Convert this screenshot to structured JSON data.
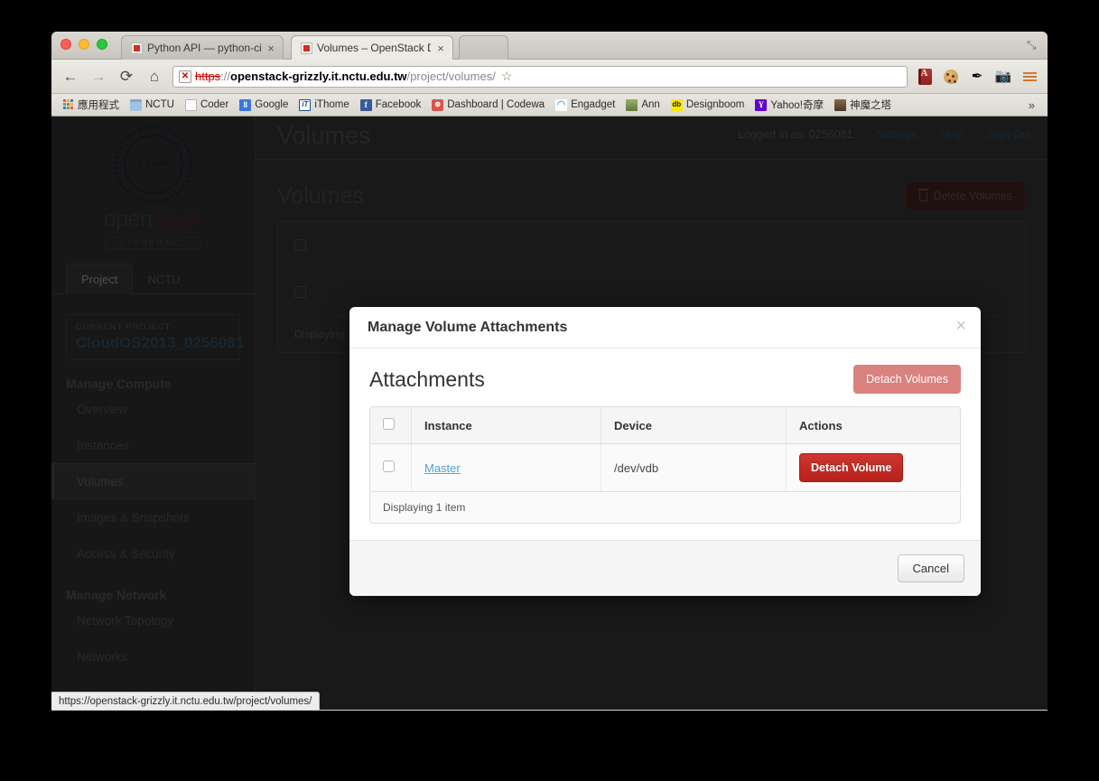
{
  "browser": {
    "tabs": [
      {
        "title": "Python API — python-cind",
        "favicon": "red-square-favicon",
        "active": false,
        "close": "×"
      },
      {
        "title": "Volumes – OpenStack Dash",
        "favicon": "red-square-favicon",
        "active": true,
        "close": "×"
      }
    ],
    "nav": {
      "back": "←",
      "forward": "→",
      "reload": "⟳",
      "home": "⌂"
    },
    "omnibox": {
      "ssl_glyph": "✕",
      "scheme": "https",
      "separator": "://",
      "host": "openstack-grizzly.it.nctu.edu.tw",
      "path": "/project/volumes/",
      "star": "☆"
    },
    "extensions": [
      {
        "name": "dictionary-extension-icon",
        "glyph": "A"
      },
      {
        "name": "cookie-extension-icon",
        "glyph": ""
      },
      {
        "name": "eyedropper-extension-icon",
        "glyph": "✒"
      },
      {
        "name": "screenshot-camera-extension-icon",
        "glyph": "📷"
      }
    ],
    "menu_label": "chrome-menu",
    "expand_glyph": "⤡",
    "bookmarks": [
      {
        "label": "應用程式",
        "icon": "apps-grid-icon"
      },
      {
        "label": "NCTU",
        "icon": "folder-icon"
      },
      {
        "label": "Coder",
        "icon": "page-icon"
      },
      {
        "label": "Google",
        "icon": "google-icon",
        "glyph": "8"
      },
      {
        "label": "iThome",
        "icon": "ithome-icon",
        "glyph": "iT"
      },
      {
        "label": "Facebook",
        "icon": "facebook-icon",
        "glyph": "f"
      },
      {
        "label": "Dashboard | Codewa",
        "icon": "codewars-icon",
        "glyph": "⊛"
      },
      {
        "label": "Engadget",
        "icon": "engadget-rss-icon",
        "glyph": "◠"
      },
      {
        "label": "Ann",
        "icon": "photo-thumbnail-icon",
        "glyph": ""
      },
      {
        "label": "Designboom",
        "icon": "designboom-icon",
        "glyph": "db"
      },
      {
        "label": "Yahoo!奇摩",
        "icon": "yahoo-icon",
        "glyph": "Y"
      },
      {
        "label": "神魔之塔",
        "icon": "tower-of-saviors-icon",
        "glyph": ""
      }
    ],
    "bookmarks_overflow": "»"
  },
  "status_bar": {
    "url": "https://openstack-grizzly.it.nctu.edu.tw/project/volumes/"
  },
  "sidebar": {
    "brand": {
      "seal_text": "E S 1896",
      "word_open": "open",
      "word_stack": "stack",
      "sub": "DASHBOARD"
    },
    "project_tabs": [
      {
        "label": "Project",
        "active": true
      },
      {
        "label": "NCTU",
        "active": false
      }
    ],
    "current_project": {
      "label": "CURRENT PROJECT",
      "value": "CloudOS2013_0256081"
    },
    "groups": [
      {
        "title": "Manage Compute",
        "items": [
          {
            "label": "Overview",
            "active": false
          },
          {
            "label": "Instances",
            "active": false
          },
          {
            "label": "Volumes",
            "active": true
          },
          {
            "label": "Images & Snapshots",
            "active": false
          },
          {
            "label": "Access & Security",
            "active": false
          }
        ]
      },
      {
        "title": "Manage Network",
        "items": [
          {
            "label": "Network Topology",
            "active": false
          },
          {
            "label": "Networks",
            "active": false
          }
        ]
      }
    ]
  },
  "header": {
    "page_title": "Volumes",
    "logged_in": "Logged in as: 0256081",
    "links": [
      {
        "label": "Settings"
      },
      {
        "label": "Help"
      },
      {
        "label": "Sign Out"
      }
    ]
  },
  "main": {
    "section_title": "Volumes",
    "delete_volumes_label": "Delete Volumes",
    "footer_text": "Displaying"
  },
  "modal": {
    "title": "Manage Volume Attachments",
    "close_glyph": "×",
    "section_title": "Attachments",
    "detach_volumes_label": "Detach Volumes",
    "table": {
      "columns": [
        "",
        "Instance",
        "Device",
        "Actions"
      ],
      "rows": [
        {
          "checked": false,
          "instance": "Master",
          "device": "/dev/vdb",
          "action_label": "Detach Volume"
        }
      ],
      "footer": "Displaying 1 item"
    },
    "cancel_label": "Cancel"
  },
  "colors": {
    "danger": "#cc2a24",
    "danger_muted": "#d9827e",
    "link": "#4ea3d8",
    "page_bg": "#2f2f2f",
    "modal_bg": "#ffffff"
  }
}
